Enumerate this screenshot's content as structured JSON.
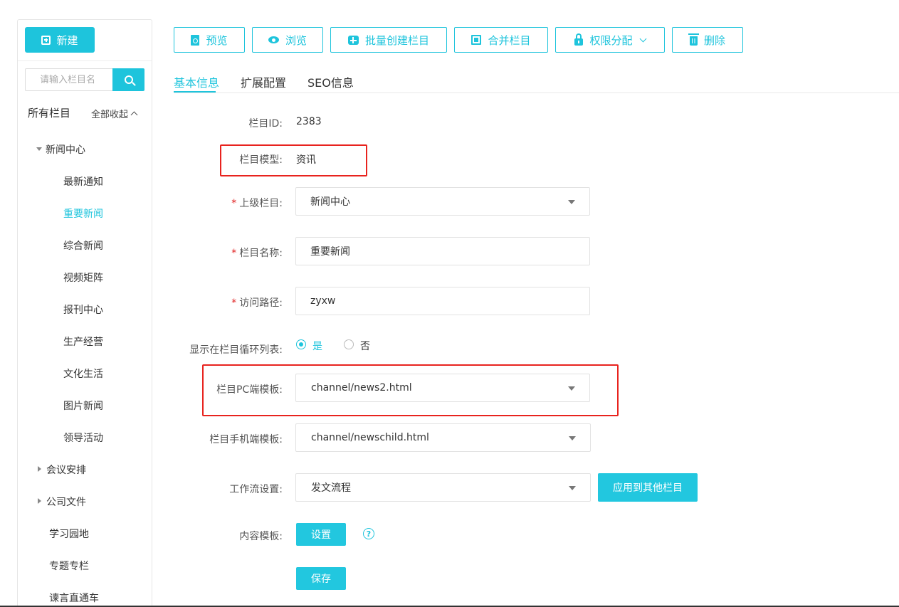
{
  "sidebar": {
    "new_label": "新建",
    "search_placeholder": "请输入栏目名",
    "all_columns": "所有栏目",
    "collapse_all": "全部收起",
    "tree": {
      "news_center": "新闻中心",
      "news_children": [
        "最新通知",
        "重要新闻",
        "综合新闻",
        "视频矩阵",
        "报刊中心",
        "生产经营",
        "文化生活",
        "图片新闻",
        "领导活动"
      ],
      "meeting": "会议安排",
      "company_docs": "公司文件",
      "study": "学习园地",
      "special": "专题专栏",
      "suggestion": "谏言直通车"
    },
    "active_item": "重要新闻"
  },
  "toolbar": {
    "preview": "预览",
    "browse": "浏览",
    "batch_create": "批量创建栏目",
    "merge": "合并栏目",
    "permissions": "权限分配",
    "delete": "删除"
  },
  "tabs": [
    "基本信息",
    "扩展配置",
    "SEO信息"
  ],
  "form": {
    "column_id_label": "栏目ID:",
    "column_id": "2383",
    "model_label": "栏目模型:",
    "model": "资讯",
    "parent_label": "上级栏目:",
    "parent": "新闻中心",
    "name_label": "栏目名称:",
    "name": "重要新闻",
    "path_label": "访问路径:",
    "path": "zyxw",
    "show_in_list_label": "显示在栏目循环列表:",
    "yes": "是",
    "no": "否",
    "pc_template_label": "栏目PC端模板:",
    "pc_template": "channel/news2.html",
    "mobile_template_label": "栏目手机端模板:",
    "mobile_template": "channel/newschild.html",
    "workflow_label": "工作流设置:",
    "workflow": "发文流程",
    "apply_other": "应用到其他栏目",
    "content_template_label": "内容模板:",
    "settings": "设置",
    "help": "?",
    "save": "保存"
  },
  "colors": {
    "accent": "#1ec4dc",
    "highlight": "#e8231e",
    "required": "#e02020"
  }
}
